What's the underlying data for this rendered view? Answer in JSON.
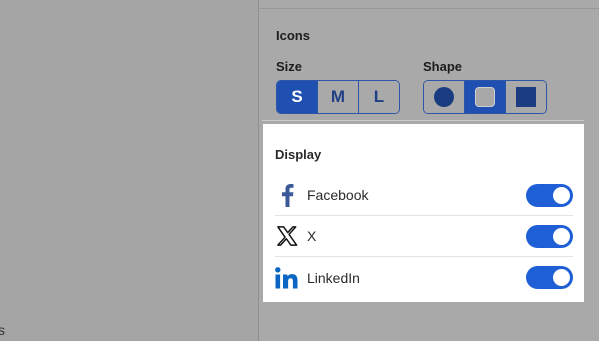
{
  "canvas": {
    "tail_text": "s"
  },
  "icons_panel": {
    "title": "Icons",
    "size": {
      "label": "Size",
      "options": [
        "S",
        "M",
        "L"
      ],
      "selected": "S"
    },
    "shape": {
      "label": "Shape",
      "options": [
        "circle-icon",
        "rounded-square-icon",
        "square-icon"
      ],
      "selected": "rounded-square-icon"
    }
  },
  "display": {
    "title": "Display",
    "items": [
      {
        "label": "Facebook",
        "icon": "facebook-icon",
        "enabled": true,
        "color": "#3b5998"
      },
      {
        "label": "X",
        "icon": "x-icon",
        "enabled": true,
        "color": "#000000"
      },
      {
        "label": "LinkedIn",
        "icon": "linkedin-icon",
        "enabled": true,
        "color": "#0a66c2"
      }
    ]
  },
  "colors": {
    "accent": "#1f4fb0",
    "toggle_on": "#1f5fd6",
    "overlay": "#a9a9a9"
  }
}
